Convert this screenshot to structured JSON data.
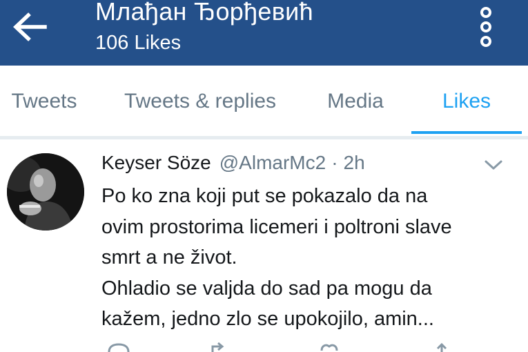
{
  "header": {
    "title": "Млађан Ђорђевић",
    "subtitle": "106 Likes",
    "back_icon": "arrow-left-icon",
    "more_icon": "more-vertical-icon"
  },
  "tabs": [
    {
      "label": "Tweets",
      "active": false
    },
    {
      "label": "Tweets & replies",
      "active": false
    },
    {
      "label": "Media",
      "active": false
    },
    {
      "label": "Likes",
      "active": true
    }
  ],
  "tweet": {
    "author_name": "Keyser Söze",
    "author_handle": "@AlmarMc2",
    "separator": "·",
    "time": "2h",
    "text_lines": [
      "Po ko zna koji put se pokazalo da na",
      "ovim prostorima licemeri i poltroni slave",
      "smrt a ne život.",
      "Ohladio se valjda do sad pa mogu da",
      "kažem, jedno zlo se upokojilo, amin..."
    ],
    "actions": [
      "reply-icon",
      "retweet-icon",
      "like-icon",
      "share-icon"
    ]
  },
  "colors": {
    "header_bg": "#24508a",
    "accent": "#1da1f2",
    "muted": "#657786",
    "text": "#14171a"
  }
}
